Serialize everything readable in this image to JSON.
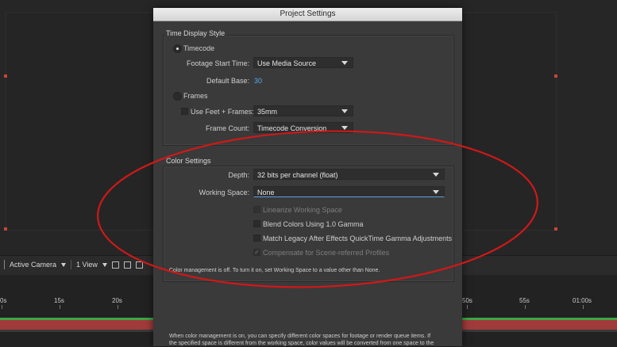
{
  "dialog": {
    "title": "Project Settings",
    "time_display": {
      "group_label": "Time Display Style",
      "timecode_label": "Timecode",
      "timecode_selected": true,
      "footage_start_label": "Footage Start Time:",
      "footage_start_value": "Use Media Source",
      "default_base_label": "Default Base:",
      "default_base_value": "30",
      "frames_label": "Frames",
      "frames_selected": false,
      "feet_frames_label": "Use Feet + Frames:",
      "feet_frames_value": "35mm",
      "frame_count_label": "Frame Count:",
      "frame_count_value": "Timecode Conversion"
    },
    "color": {
      "group_label": "Color Settings",
      "depth_label": "Depth:",
      "depth_value": "32 bits per channel (float)",
      "working_space_label": "Working Space:",
      "working_space_value": "None",
      "linearize_label": "Linearize Working Space",
      "blend_label": "Blend Colors Using 1.0 Gamma",
      "legacy_label": "Match Legacy After Effects QuickTime Gamma Adjustments",
      "compensate_label": "Compensate for Scene-referred Profiles",
      "compensate_checked": true,
      "info_text": "Color management is off. To turn it on, set Working Space to a value other than None."
    },
    "bottom_note_line1": "When color management is on, you can specify different color spaces for footage or render queue items. If",
    "bottom_note_line2": "the specified space is different from the working space, color values will be converted from one space to the"
  },
  "viewer": {
    "camera_label": "Active Camera",
    "view_label": "1 View"
  },
  "timeline": {
    "ticks_left": [
      "0s",
      "15s",
      "20s"
    ],
    "ticks_right": [
      "50s",
      "55s",
      "01:00s"
    ]
  },
  "colors": {
    "accent": "#5aa8e8",
    "annotation": "#d01818",
    "handle": "#c8443c"
  }
}
